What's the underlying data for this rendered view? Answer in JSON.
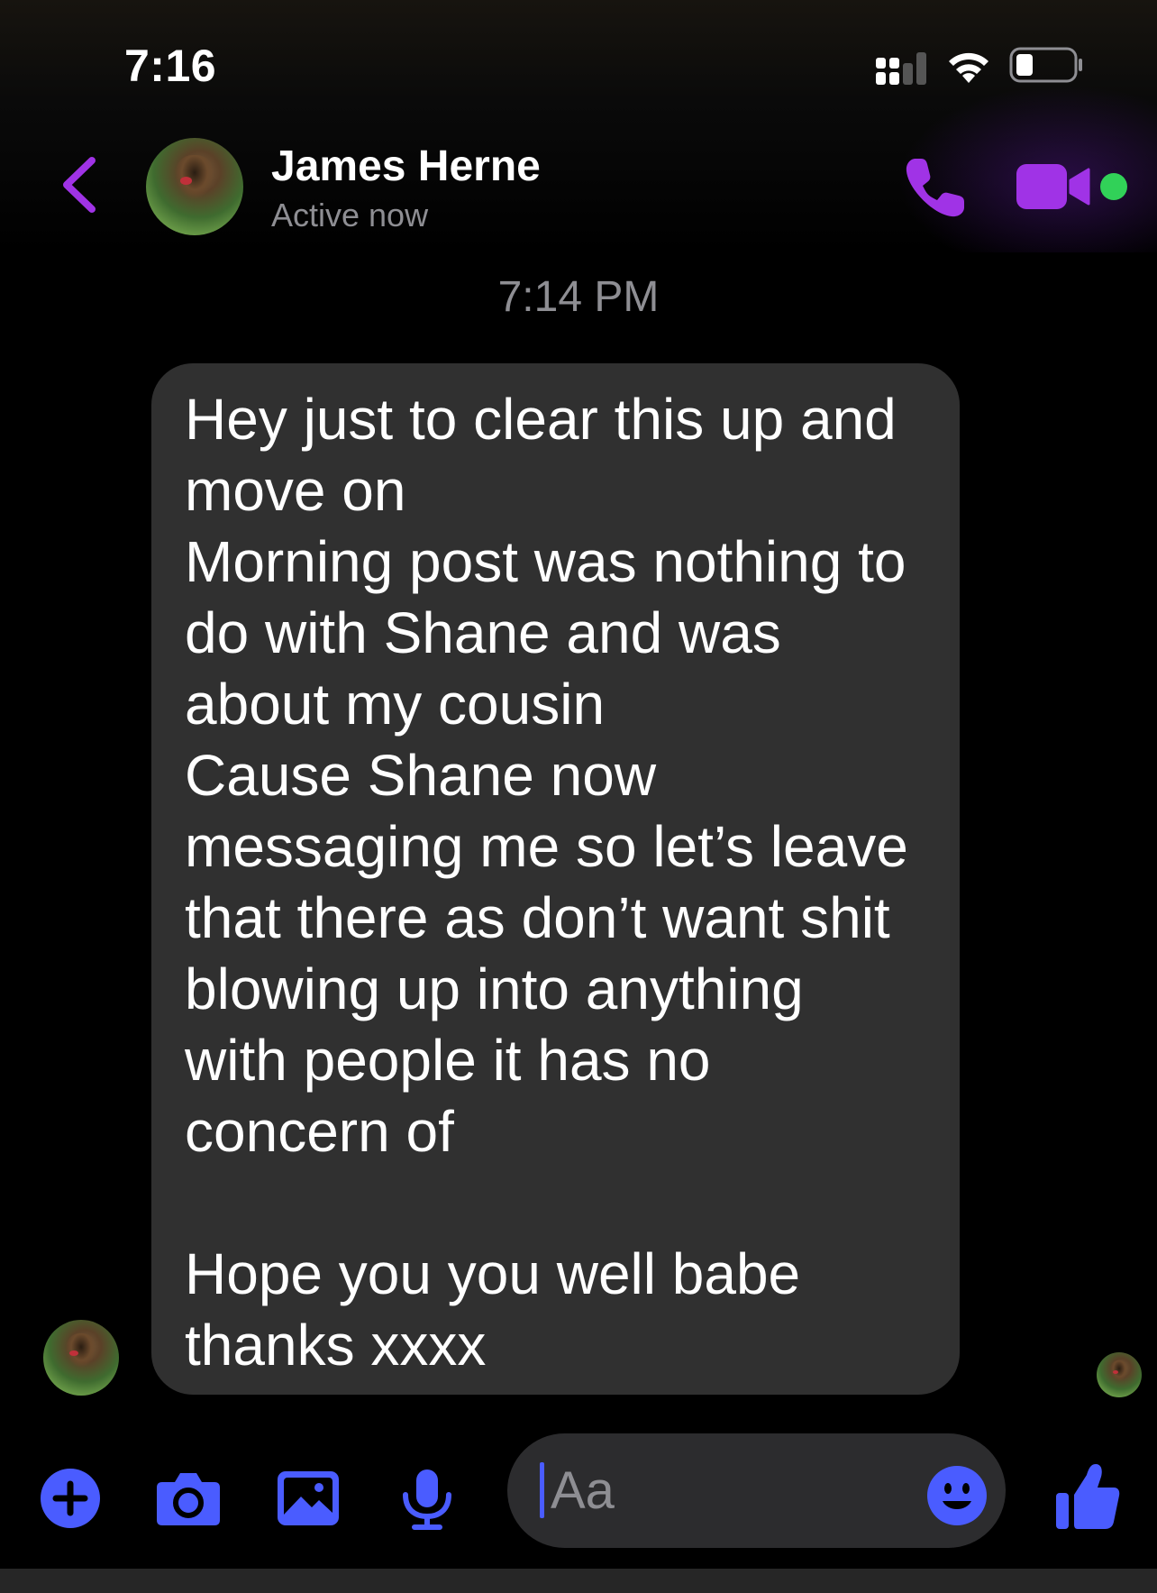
{
  "status_bar": {
    "time": "7:16"
  },
  "header": {
    "contact_name": "James Herne",
    "contact_status": "Active now",
    "back_icon": "chevron-left-icon",
    "call_icon": "phone-icon",
    "video_icon": "video-camera-icon",
    "online_indicator_color": "#31d158"
  },
  "thread": {
    "timestamp": "7:14 PM",
    "messages": [
      {
        "sender": "James Herne",
        "text": "Hey just to clear this up and\nmove on\nMorning post was nothing to\ndo with Shane and was\nabout my cousin\nCause Shane now\nmessaging me so let’s leave\nthat there as don’t want shit\nblowing up into anything\nwith people it has no\nconcern of\n\nHope you you well babe\nthanks xxxx"
      }
    ]
  },
  "composer": {
    "placeholder": "Aa",
    "tool_icons": [
      "plus-icon",
      "camera-icon",
      "image-icon",
      "microphone-icon"
    ],
    "emoji_icon": "smiley-icon",
    "send_icon": "thumbs-up-icon"
  },
  "colors": {
    "accent_purple": "#a033e6",
    "accent_blue": "#4a5cff",
    "bubble_bg": "#303030",
    "secondary_text": "#8e8e93"
  }
}
